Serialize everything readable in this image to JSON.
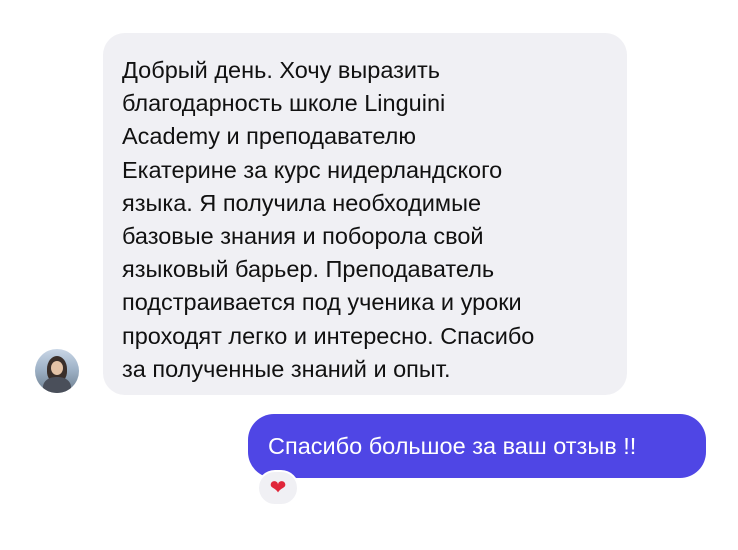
{
  "conversation": {
    "incoming": {
      "text": "Добрый день. Хочу выразить\nблагодарность школе Linguini\nAcademy  и преподавателю\nЕкатерине за курс нидерландского\nязыка. Я получила необходимые\nбазовые знания и поборола свой\nязыковый барьер. Преподаватель\nподстраивается под ученика и уроки\nпроходят легко и интересно. Спасибо\nза полученные знаний и опыт."
    },
    "outgoing": {
      "text": "Спасибо большое за ваш отзыв !!",
      "reaction_icon": "heart-icon",
      "reaction_glyph": "❤"
    }
  },
  "colors": {
    "incoming_bubble": "#f0f0f4",
    "outgoing_bubble": "#4f46e5",
    "reaction_heart": "#e0263a"
  }
}
